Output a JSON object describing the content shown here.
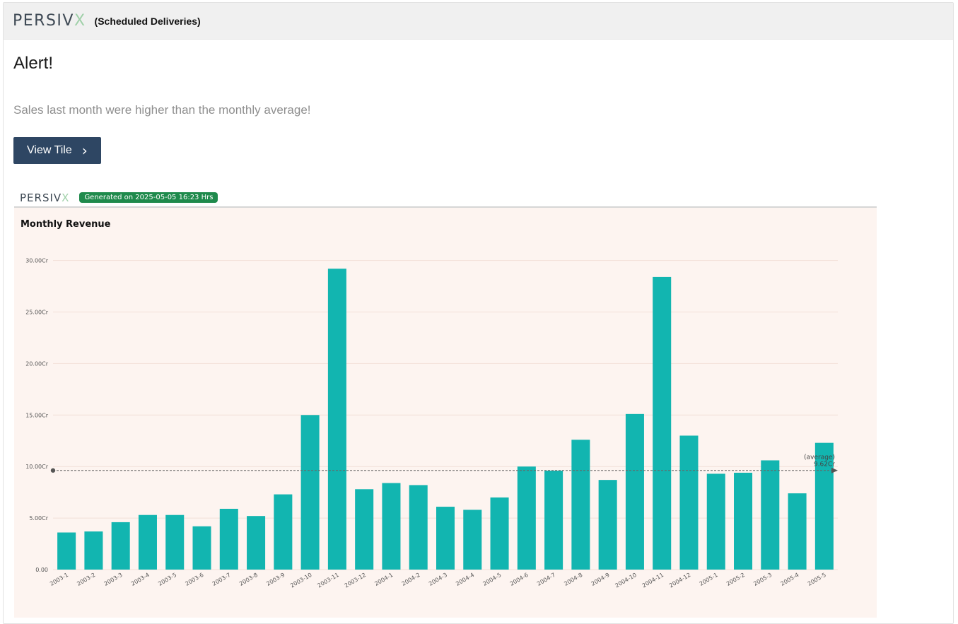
{
  "header": {
    "logo_main": "PERSIV",
    "logo_x": "X",
    "subtitle": "(Scheduled Deliveries)"
  },
  "alert": {
    "title": "Alert!",
    "message": "Sales last month were higher than the monthly average!",
    "button_label": "View Tile",
    "button_icon": "chevron-right-icon"
  },
  "report": {
    "logo_main": "PERSIV",
    "logo_x": "X",
    "generated_badge": "Generated on 2025-05-05 16:23 Hrs",
    "badge_color": "#1f8a4c"
  },
  "colors": {
    "bar": "#12b5b0",
    "header_bg": "#f0f0f0",
    "button_bg": "#2e4663",
    "chart_bg": "#fdf4f0"
  },
  "chart_data": {
    "type": "bar",
    "title": "Monthly Revenue",
    "xlabel": "",
    "ylabel": "",
    "ylim": [
      0,
      31
    ],
    "yticks": [
      0,
      5,
      10,
      15,
      20,
      25,
      30
    ],
    "ytick_labels": [
      "0.00",
      "5.00Cr",
      "10.00Cr",
      "15.00Cr",
      "20.00Cr",
      "25.00Cr",
      "30.00Cr"
    ],
    "grid": true,
    "legend": "none",
    "categories": [
      "2003-1",
      "2003-2",
      "2003-3",
      "2003-4",
      "2003-5",
      "2003-6",
      "2003-7",
      "2003-8",
      "2003-9",
      "2003-10",
      "2003-11",
      "2003-12",
      "2004-1",
      "2004-2",
      "2004-3",
      "2004-4",
      "2004-5",
      "2004-6",
      "2004-7",
      "2004-8",
      "2004-9",
      "2004-10",
      "2004-11",
      "2004-12",
      "2005-1",
      "2005-2",
      "2005-3",
      "2005-4",
      "2005-5"
    ],
    "values": [
      3.6,
      3.7,
      4.6,
      5.3,
      5.3,
      4.2,
      5.9,
      5.2,
      7.3,
      15.0,
      29.2,
      7.8,
      8.4,
      8.2,
      6.1,
      5.8,
      7.0,
      10.0,
      9.6,
      12.6,
      8.7,
      15.1,
      28.4,
      13.0,
      9.3,
      9.4,
      10.6,
      7.4,
      12.3
    ],
    "average": {
      "value": 9.62,
      "label_line1": "(average)",
      "label_line2": "9.62Cr"
    }
  }
}
